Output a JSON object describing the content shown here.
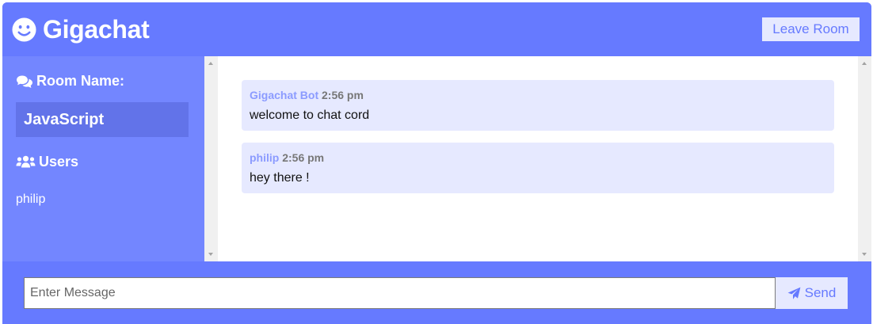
{
  "header": {
    "brand_icon": "smile-icon",
    "title": "Gigachat",
    "leave_label": "Leave Room"
  },
  "sidebar": {
    "room_heading_icon": "comments-icon",
    "room_heading": "Room Name:",
    "room_name": "JavaScript",
    "users_heading_icon": "users-icon",
    "users_heading": "Users",
    "users": [
      "philip"
    ]
  },
  "messages": [
    {
      "user": "Gigachat Bot",
      "time": "2:56 pm",
      "text": "welcome to chat cord"
    },
    {
      "user": "philip",
      "time": "2:56 pm",
      "text": "hey there !"
    }
  ],
  "composer": {
    "placeholder": "Enter Message",
    "value": "",
    "send_icon": "paper-plane-icon",
    "send_label": "Send"
  },
  "colors": {
    "primary": "#667aff",
    "sidebar": "#7386ff",
    "room_name_bg": "#6273e9",
    "light": "#e6e9ff",
    "username": "#8b9bff",
    "time": "#777777"
  }
}
